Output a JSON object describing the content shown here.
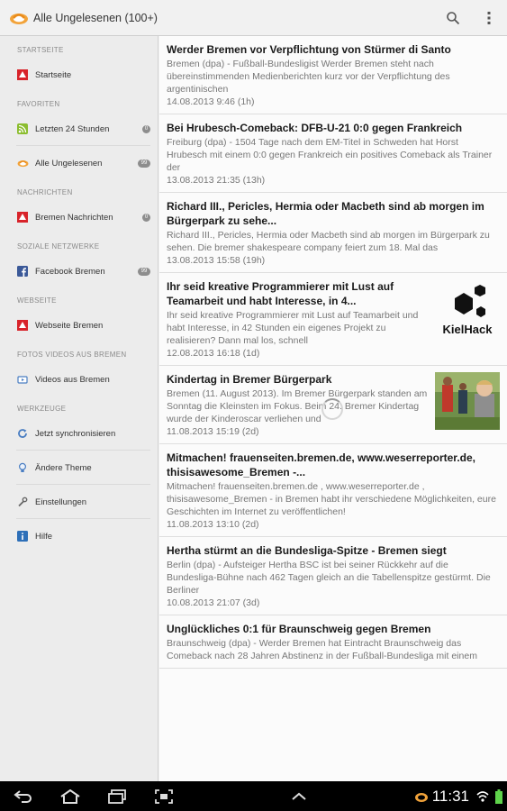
{
  "header": {
    "title": "Alle Ungelesenen (100+)",
    "icons": [
      "app-logo-icon",
      "search-icon",
      "overflow-menu-icon"
    ]
  },
  "sidebar": {
    "sections": [
      {
        "title": "STARTSEITE",
        "items": [
          {
            "label": "Startseite",
            "icon": "bremen-logo-icon",
            "badge": ""
          }
        ]
      },
      {
        "title": "FAVORITEN",
        "items": [
          {
            "label": "Letzten 24 Stunden",
            "icon": "rss-icon",
            "badge": "0"
          },
          {
            "label": "Alle Ungelesenen",
            "icon": "app-logo-icon",
            "badge": "99"
          }
        ]
      },
      {
        "title": "NACHRICHTEN",
        "items": [
          {
            "label": "Bremen Nachrichten",
            "icon": "bremen-logo-icon",
            "badge": "0"
          }
        ]
      },
      {
        "title": "SOZIALE NETZWERKE",
        "items": [
          {
            "label": "Facebook Bremen",
            "icon": "facebook-icon",
            "badge": "99"
          }
        ]
      },
      {
        "title": "WEBSEITE",
        "items": [
          {
            "label": "Webseite Bremen",
            "icon": "bremen-logo-icon",
            "badge": ""
          }
        ]
      },
      {
        "title": "FOTOS VIDEOS AUS BREMEN",
        "items": [
          {
            "label": "Videos aus Bremen",
            "icon": "video-icon",
            "badge": ""
          }
        ]
      },
      {
        "title": "WERKZEUGE",
        "items": [
          {
            "label": "Jetzt synchronisieren",
            "icon": "sync-icon",
            "badge": ""
          },
          {
            "label": "Ändere Theme",
            "icon": "lightbulb-icon",
            "badge": ""
          },
          {
            "label": "Einstellungen",
            "icon": "wrench-icon",
            "badge": ""
          },
          {
            "label": "Hilfe",
            "icon": "info-icon",
            "badge": ""
          }
        ]
      }
    ]
  },
  "articles": [
    {
      "title": "Werder Bremen vor Verpflichtung von Stürmer di Santo",
      "text": "Bremen (dpa) - Fußball-Bundesligist Werder Bremen steht nach übereinstimmenden Medienberichten kurz vor der Verpflichtung des argentinischen",
      "date": "14.08.2013 9:46 (1h)",
      "thumb": ""
    },
    {
      "title": "Bei Hrubesch-Comeback: DFB-U-21 0:0 gegen Frankreich",
      "text": "Freiburg (dpa) - 1504 Tage nach dem EM-Titel in Schweden hat Horst Hrubesch mit einem 0:0 gegen Frankreich ein positives Comeback als Trainer der",
      "date": "13.08.2013 21:35 (13h)",
      "thumb": ""
    },
    {
      "title": "Richard III., Pericles, Hermia oder Macbeth sind ab morgen im Bürgerpark zu sehe...",
      "text": "Richard III., Pericles, Hermia oder Macbeth sind ab morgen im Bürgerpark zu sehen. Die bremer shakespeare company feiert zum 18. Mal das",
      "date": "13.08.2013 15:58 (19h)",
      "thumb": ""
    },
    {
      "title": "Ihr seid kreative Programmierer mit Lust auf Teamarbeit und habt Interesse, in 4...",
      "text": "Ihr seid kreative Programmierer mit Lust auf Teamarbeit und habt Interesse, in 42 Stunden ein eigenes Projekt zu realisieren? Dann mal los, schnell",
      "date": "12.08.2013 16:18 (1d)",
      "thumb": "kielhack",
      "thumb_text": "KielHack"
    },
    {
      "title": "Kindertag in Bremer Bürgerpark",
      "text": "Bremen (11. August 2013). Im Bremer Bürgerpark standen am Sonntag die Kleinsten im Fokus. Beim 24. Bremer Kindertag wurde der Kinderoscar verliehen und",
      "date": "11.08.2013 15:19 (2d)",
      "thumb": "photo"
    },
    {
      "title": "Mitmachen! frauenseiten.bremen.de, www.weserreporter.de, thisisawesome_Bremen -...",
      "text": "Mitmachen! frauenseiten.bremen.de , www.weserreporter.de , thisisawesome_Bremen - in Bremen habt ihr verschiedene Möglichkeiten, eure Geschichten im Internet zu veröffentlichen!",
      "date": "11.08.2013 13:10 (2d)",
      "thumb": ""
    },
    {
      "title": "Hertha stürmt an die Bundesliga-Spitze - Bremen siegt",
      "text": "Berlin (dpa) - Aufsteiger Hertha BSC ist bei seiner Rückkehr auf die Bundesliga-Bühne nach 462 Tagen gleich an die Tabellenspitze gestürmt. Die Berliner",
      "date": "10.08.2013 21:07 (3d)",
      "thumb": ""
    },
    {
      "title": "Unglückliches 0:1 für Braunschweig gegen Bremen",
      "text": "Braunschweig (dpa) - Werder Bremen hat Eintracht Braunschweig das Comeback nach 28 Jahren Abstinenz in der Fußball-Bundesliga mit einem",
      "date": "",
      "thumb": ""
    }
  ],
  "statusbar": {
    "time": "11:31",
    "icons": [
      "back-icon",
      "home-icon",
      "recent-apps-icon",
      "screenshot-icon",
      "up-arrow-icon",
      "notification-icon",
      "wifi-icon",
      "battery-icon"
    ]
  }
}
